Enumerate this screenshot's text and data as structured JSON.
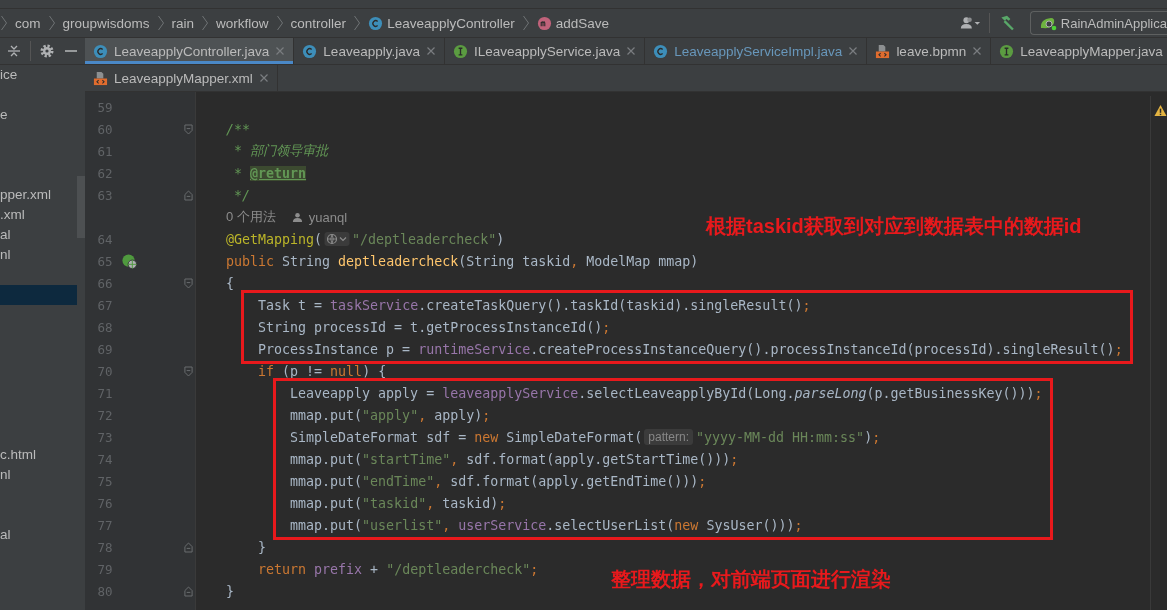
{
  "breadcrumb": [
    {
      "kind": "package",
      "text": "com"
    },
    {
      "kind": "package",
      "text": "groupwisdoms"
    },
    {
      "kind": "package",
      "text": "rain"
    },
    {
      "kind": "package",
      "text": "workflow"
    },
    {
      "kind": "package",
      "text": "controller"
    },
    {
      "kind": "class",
      "text": "LeaveapplyController"
    },
    {
      "kind": "method",
      "text": "addSave"
    }
  ],
  "toolbar": {
    "run_config": "RainAdminApplica"
  },
  "tab_rows": [
    {
      "tabs": [
        {
          "label": "LeaveapplyController.java",
          "kind": "class",
          "selected": true,
          "modified": false
        },
        {
          "label": "Leaveapply.java",
          "kind": "class",
          "selected": false,
          "modified": false
        },
        {
          "label": "ILeaveapplyService.java",
          "kind": "interface",
          "selected": false,
          "modified": false
        },
        {
          "label": "LeaveapplyServiceImpl.java",
          "kind": "class",
          "selected": false,
          "modified": true
        },
        {
          "label": "leave.bpmn",
          "kind": "xml",
          "selected": false,
          "modified": false
        },
        {
          "label": "LeaveapplyMapper.java",
          "kind": "interface",
          "selected": false,
          "modified": false
        }
      ]
    },
    {
      "tabs": [
        {
          "label": "LeaveapplyMapper.xml",
          "kind": "xml",
          "selected": false,
          "modified": false
        }
      ]
    }
  ],
  "sidebar": {
    "rows": [
      {
        "text": "ice",
        "selected": false
      },
      {
        "selected": false
      },
      {
        "text": "e",
        "selected": false
      },
      {
        "selected": false
      },
      {
        "selected": false
      },
      {
        "selected": false
      },
      {
        "text": "pper.xml",
        "selected": false
      },
      {
        "text": ".xml",
        "selected": false
      },
      {
        "text": "al",
        "selected": false
      },
      {
        "text": "nl",
        "selected": false
      },
      {
        "selected": false
      },
      {
        "selected": true
      },
      {
        "selected": false
      },
      {
        "selected": false
      },
      {
        "selected": false
      },
      {
        "selected": false
      },
      {
        "selected": false
      },
      {
        "selected": false
      },
      {
        "selected": false
      },
      {
        "text": "c.html",
        "selected": false
      },
      {
        "text": "nl",
        "selected": false
      },
      {
        "selected": false
      },
      {
        "selected": false
      },
      {
        "text": "al",
        "selected": false
      }
    ]
  },
  "editor": {
    "blocks": [
      {
        "kind": "line",
        "number": "59"
      },
      {
        "kind": "line",
        "number": "60",
        "fold_start": true,
        "tokens": [
          {
            "kind": "comment",
            "text": "/**"
          }
        ]
      },
      {
        "kind": "line",
        "number": "61",
        "tokens": [
          {
            "kind": "comment",
            "text": " * 部门领导审批"
          }
        ]
      },
      {
        "kind": "line",
        "number": "62",
        "tokens": [
          {
            "kind": "comment",
            "text": " * "
          },
          {
            "kind": "doc_tag",
            "text": "@return"
          }
        ]
      },
      {
        "kind": "line",
        "number": "63",
        "fold_end": true,
        "tokens": [
          {
            "kind": "comment",
            "text": " */"
          }
        ]
      },
      {
        "kind": "hint",
        "usages": "0 个用法",
        "author": "yuanql"
      },
      {
        "kind": "line",
        "number": "64",
        "tokens": [
          {
            "kind": "annot",
            "text": "@GetMapping"
          },
          {
            "kind": "plain",
            "text": "("
          },
          {
            "kind": "url_inlay"
          },
          {
            "kind": "str",
            "text": "\"/deptleadercheck\""
          },
          {
            "kind": "plain",
            "text": ")"
          }
        ]
      },
      {
        "kind": "line",
        "number": "65",
        "endpoint": true,
        "tokens": [
          {
            "kind": "kw",
            "text": "public "
          },
          {
            "kind": "plain",
            "text": "String "
          },
          {
            "kind": "decl",
            "text": "deptleadercheck"
          },
          {
            "kind": "plain",
            "text": "(String taskid"
          },
          {
            "kind": "kw",
            "text": ","
          },
          {
            "kind": "plain",
            "text": " ModelMap mmap)"
          }
        ]
      },
      {
        "kind": "line",
        "number": "66",
        "fold_start": true,
        "tokens": [
          {
            "kind": "plain",
            "text": "{"
          }
        ]
      },
      {
        "kind": "box",
        "note": "根据**taskid**获取到对应到数据表中的数据**id**",
        "note_below": false,
        "lines": [
          {
            "kind": "line",
            "number": "67",
            "tokens": [
              {
                "kind": "plain",
                "text": "    Task t = "
              },
              {
                "kind": "field",
                "text": "taskService"
              },
              {
                "kind": "plain",
                "text": ".createTaskQuery().taskId(taskid).singleResult()"
              },
              {
                "kind": "kw",
                "text": ";"
              }
            ]
          },
          {
            "kind": "line",
            "number": "68",
            "tokens": [
              {
                "kind": "plain",
                "text": "    String processId = t.getProcessInstanceId()"
              },
              {
                "kind": "kw",
                "text": ";"
              }
            ]
          },
          {
            "kind": "line",
            "number": "69",
            "tokens": [
              {
                "kind": "plain",
                "text": "    ProcessInstance p = "
              },
              {
                "kind": "field",
                "text": "runtimeService"
              },
              {
                "kind": "plain",
                "text": ".createProcessInstanceQuery().processInstanceId(processId).singleResult()"
              },
              {
                "kind": "kw",
                "text": ";"
              }
            ]
          }
        ]
      },
      {
        "kind": "line",
        "number": "70",
        "fold_start": true,
        "tokens": [
          {
            "kind": "kw",
            "text": "    if"
          },
          {
            "kind": "plain",
            "text": " (p != "
          },
          {
            "kind": "kw",
            "text": "null"
          },
          {
            "kind": "plain",
            "text": ") {"
          }
        ]
      },
      {
        "kind": "box",
        "note": "整理数据，对前端页面进行渲染",
        "note_below": true,
        "lines": [
          {
            "kind": "line",
            "number": "71",
            "tokens": [
              {
                "kind": "plain",
                "text": "        Leaveapply apply = "
              },
              {
                "kind": "field",
                "text": "leaveapplyService"
              },
              {
                "kind": "plain",
                "text": ".selectLeaveapplyById(Long."
              },
              {
                "kind": "italic",
                "text": "parseLong"
              },
              {
                "kind": "plain",
                "text": "(p.getBusinessKey()))"
              },
              {
                "kind": "kw",
                "text": ";"
              }
            ]
          },
          {
            "kind": "line",
            "number": "72",
            "tokens": [
              {
                "kind": "plain",
                "text": "        mmap.put("
              },
              {
                "kind": "str",
                "text": "\"apply\""
              },
              {
                "kind": "kw",
                "text": ","
              },
              {
                "kind": "plain",
                "text": " apply)"
              },
              {
                "kind": "kw",
                "text": ";"
              }
            ]
          },
          {
            "kind": "line",
            "number": "73",
            "tokens": [
              {
                "kind": "plain",
                "text": "        SimpleDateFormat sdf = "
              },
              {
                "kind": "kw",
                "text": "new"
              },
              {
                "kind": "plain",
                "text": " SimpleDateFormat("
              },
              {
                "kind": "param_hint",
                "text": "pattern:"
              },
              {
                "kind": "str",
                "text": "\"yyyy-MM-dd HH:mm:ss\""
              },
              {
                "kind": "plain",
                "text": ")"
              },
              {
                "kind": "kw",
                "text": ";"
              }
            ]
          },
          {
            "kind": "line",
            "number": "74",
            "tokens": [
              {
                "kind": "plain",
                "text": "        mmap.put("
              },
              {
                "kind": "str",
                "text": "\"startTime\""
              },
              {
                "kind": "kw",
                "text": ","
              },
              {
                "kind": "plain",
                "text": " sdf.format(apply.getStartTime()))"
              },
              {
                "kind": "kw",
                "text": ";"
              }
            ]
          },
          {
            "kind": "line",
            "number": "75",
            "tokens": [
              {
                "kind": "plain",
                "text": "        mmap.put("
              },
              {
                "kind": "str",
                "text": "\"endTime\""
              },
              {
                "kind": "kw",
                "text": ","
              },
              {
                "kind": "plain",
                "text": " sdf.format(apply.getEndTime()))"
              },
              {
                "kind": "kw",
                "text": ";"
              }
            ]
          },
          {
            "kind": "line",
            "number": "76",
            "tokens": [
              {
                "kind": "plain",
                "text": "        mmap.put("
              },
              {
                "kind": "str",
                "text": "\"taskid\""
              },
              {
                "kind": "kw",
                "text": ","
              },
              {
                "kind": "plain",
                "text": " taskid)"
              },
              {
                "kind": "kw",
                "text": ";"
              }
            ]
          },
          {
            "kind": "line",
            "number": "77",
            "tokens": [
              {
                "kind": "plain",
                "text": "        mmap.put("
              },
              {
                "kind": "str",
                "text": "\"userlist\""
              },
              {
                "kind": "kw",
                "text": ","
              },
              {
                "kind": "field",
                "text": " userService"
              },
              {
                "kind": "plain",
                "text": ".selectUserList("
              },
              {
                "kind": "kw",
                "text": "new"
              },
              {
                "kind": "plain",
                "text": " SysUser()))"
              },
              {
                "kind": "kw",
                "text": ";"
              }
            ]
          }
        ]
      },
      {
        "kind": "line",
        "number": "78",
        "fold_end": true,
        "tokens": [
          {
            "kind": "plain",
            "text": "    }"
          }
        ]
      },
      {
        "kind": "line",
        "number": "79",
        "tokens": [
          {
            "kind": "kw",
            "text": "    return "
          },
          {
            "kind": "field",
            "text": "prefix"
          },
          {
            "kind": "plain",
            "text": " + "
          },
          {
            "kind": "str",
            "text": "\"/deptleadercheck\""
          },
          {
            "kind": "kw",
            "text": ";"
          }
        ]
      },
      {
        "kind": "line",
        "number": "80",
        "fold_end": true,
        "tokens": [
          {
            "kind": "plain",
            "text": "}"
          }
        ]
      }
    ]
  }
}
